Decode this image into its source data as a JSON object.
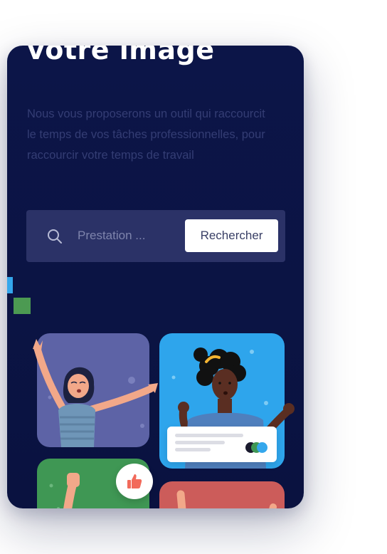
{
  "hero": {
    "title": "votre image",
    "description": "Nous vous proposerons un outil qui raccourcit le temps de vos tâches professionnelles, pour raccourcir votre temps de travail"
  },
  "search": {
    "placeholder": "Prestation ...",
    "value": "",
    "button_label": "Rechercher",
    "icon": "search-icon"
  },
  "icons": {
    "like": "thumbs-up-icon"
  },
  "colors": {
    "background": "#0b1444",
    "search_bar": "#2b3267",
    "tile_purple": "#5d63a6",
    "tile_blue": "#2ea5ec",
    "tile_green": "#3f9754",
    "tile_red": "#cc5c5a",
    "like_icon": "#f26a5b"
  }
}
